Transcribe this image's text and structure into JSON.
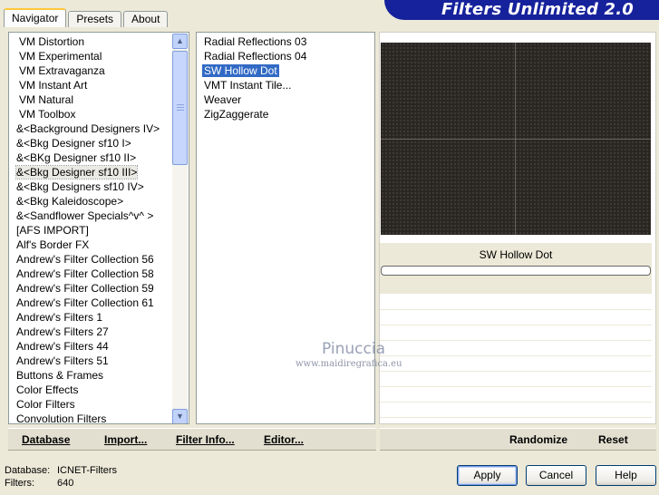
{
  "tabs": [
    {
      "label": "Navigator",
      "active": true
    },
    {
      "label": "Presets",
      "active": false
    },
    {
      "label": "About",
      "active": false
    }
  ],
  "banner": {
    "title": "Filters Unlimited 2.0"
  },
  "categories": [
    "VM Distortion",
    "VM Experimental",
    "VM Extravaganza",
    "VM Instant Art",
    "VM Natural",
    "VM Toolbox",
    "&<Background Designers IV>",
    "&<Bkg Designer sf10 I>",
    "&<BKg Designer sf10 II>",
    "&<Bkg Designer sf10 III>",
    "&<Bkg Designers sf10 IV>",
    "&<Bkg Kaleidoscope>",
    "&<Sandflower Specials^v^ >",
    "[AFS IMPORT]",
    "Alf's Border FX",
    "Andrew's Filter Collection 56",
    "Andrew's Filter Collection 58",
    "Andrew's Filter Collection 59",
    "Andrew's Filter Collection 61",
    "Andrew's Filters 1",
    "Andrew's Filters 27",
    "Andrew's Filters 44",
    "Andrew's Filters 51",
    "Buttons & Frames",
    "Color Effects",
    "Color Filters",
    "Convolution Filters"
  ],
  "selected_category_index": 9,
  "filters": [
    "Radial Reflections 03",
    "Radial Reflections 04",
    "SW Hollow Dot",
    "VMT Instant Tile...",
    "Weaver",
    "ZigZaggerate"
  ],
  "selected_filter_index": 2,
  "preview": {
    "filter_name": "SW Hollow Dot"
  },
  "watermark": {
    "name": "Pinuccia",
    "url": "www.maidiregrafica.eu"
  },
  "toolbar": {
    "database": "Database",
    "import": "Import...",
    "filter_info": "Filter Info...",
    "editor": "Editor...",
    "randomize": "Randomize",
    "reset": "Reset"
  },
  "status": {
    "database_label": "Database:",
    "database_value": "ICNET-Filters",
    "filters_label": "Filters:",
    "filters_value": "640"
  },
  "buttons": {
    "apply": "Apply",
    "cancel": "Cancel",
    "help": "Help"
  },
  "icons": {
    "scroll_up": "chevron-up-icon",
    "scroll_down": "chevron-down-icon"
  },
  "colors": {
    "banner": "#16219c",
    "selection": "#316ac5"
  }
}
